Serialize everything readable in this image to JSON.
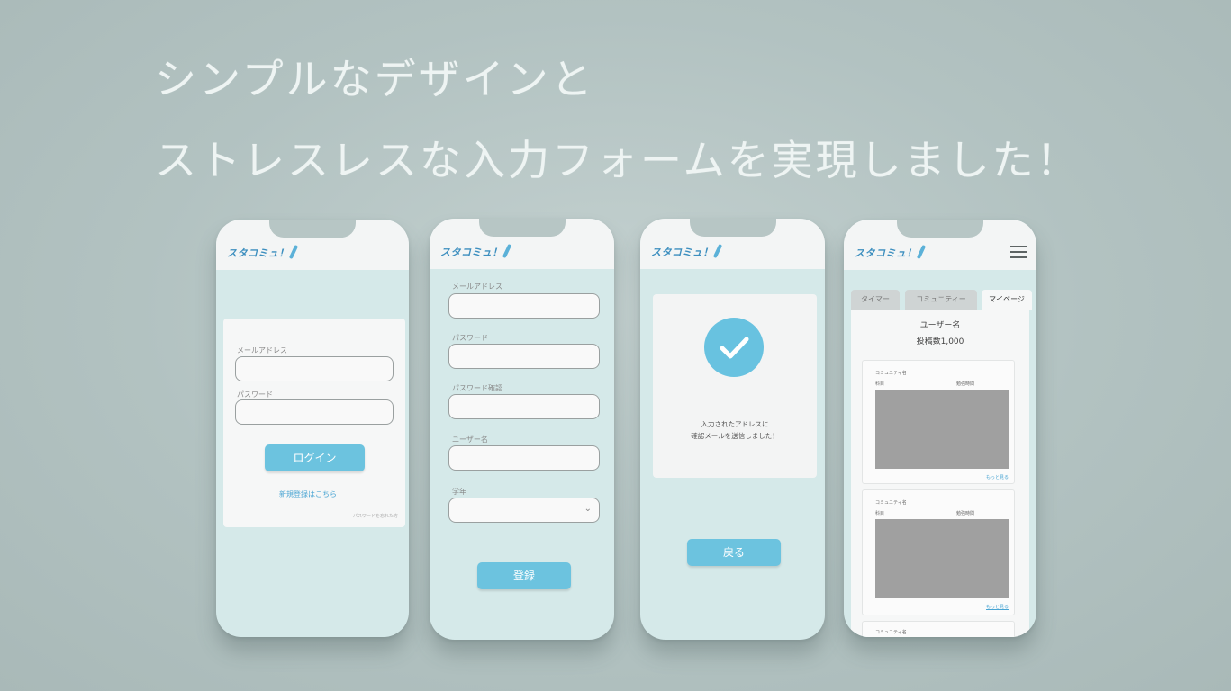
{
  "headline": {
    "line1": "シンプルなデザインと",
    "line2": "ストレスレスな入力フォームを実現しました！"
  },
  "app_logo": "スタコミュ！",
  "login_screen": {
    "email_label": "メールアドレス",
    "password_label": "パスワード",
    "login_button": "ログイン",
    "signup_link": "新規登録はこちら",
    "forgot_link": "パスワードを忘れた方"
  },
  "register_screen": {
    "email_label": "メールアドレス",
    "password_label": "パスワード",
    "password_confirm_label": "パスワード確認",
    "username_label": "ユーザー名",
    "grade_label": "学年",
    "register_button": "登録"
  },
  "confirm_screen": {
    "message_line1": "入力されたアドレスに",
    "message_line2": "確認メールを送信しました！",
    "back_button": "戻る"
  },
  "mypage_screen": {
    "tabs": [
      "タイマー",
      "コミュニティー",
      "マイページ"
    ],
    "username": "ユーザー名",
    "post_count": "投稿数1,000",
    "posts": [
      {
        "community": "コミュニティ名",
        "subject": "科目",
        "time": "勉強時間",
        "more": "もっと見る"
      },
      {
        "community": "コミュニティ名",
        "subject": "科目",
        "time": "勉強時間",
        "more": "もっと見る"
      },
      {
        "community": "コミュニティ名"
      }
    ]
  },
  "colors": {
    "background": "#b6c6c5",
    "phone_screen": "#d5e9e9",
    "accent": "#6cc3df",
    "headline": "#eef4f3"
  },
  "icons": [
    "check-icon",
    "hamburger-menu-icon",
    "chevron-down-icon",
    "pen-icon"
  ]
}
